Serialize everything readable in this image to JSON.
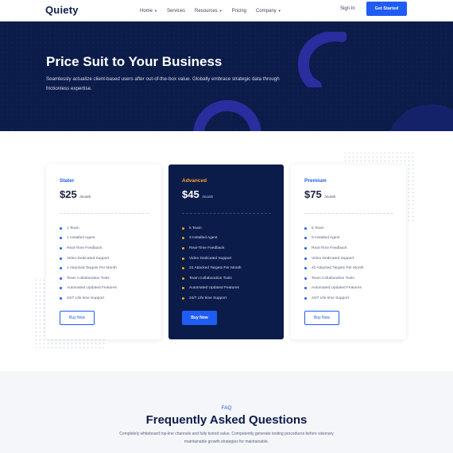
{
  "header": {
    "logo": "Quiety",
    "nav": [
      {
        "label": "Home",
        "dropdown": true
      },
      {
        "label": "Services",
        "dropdown": false
      },
      {
        "label": "Resources",
        "dropdown": true
      },
      {
        "label": "Pricing",
        "dropdown": false
      },
      {
        "label": "Company",
        "dropdown": true
      }
    ],
    "sign_in": "Sign In",
    "cta": "Get Started"
  },
  "hero": {
    "title": "Price Suit to Your Business",
    "subtitle": "Seamlessly actualize client-based users after out-of-the-box value. Globally embrace strategic data through frictionless expertise."
  },
  "plans": [
    {
      "name": "Stater",
      "price": "$25",
      "period": "/month",
      "features": [
        "1 Team",
        "1 Installed Agent",
        "Real-Time Feedback",
        "Video Dedicated Support",
        "1 Attacked Targets Per Month",
        "Team Collaboration Tools",
        "Automated Updated Features",
        "24/7 Life time Support"
      ],
      "button": "Buy Now",
      "highlighted": false
    },
    {
      "name": "Advanced",
      "price": "$45",
      "period": "/month",
      "features": [
        "5 Team",
        "3 Installed Agent",
        "Real-Time Feedback",
        "Video Dedicated Support",
        "24 Attacked Targets Per Month",
        "Team Collaboration Tools",
        "Automated Updated Features",
        "24/7 Life time Support"
      ],
      "button": "Buy Now",
      "highlighted": true
    },
    {
      "name": "Premium",
      "price": "$75",
      "period": "/month",
      "features": [
        "6 Team",
        "8 Installed Agent",
        "Real-Time Feedback",
        "Video Dedicated Support",
        "40 Attacked Targets Per Month",
        "Team Collaboration Tools",
        "Automated Updated Features",
        "24/7 Life time Support"
      ],
      "button": "Buy Now",
      "highlighted": false
    }
  ],
  "faq": {
    "tag": "FAQ",
    "title": "Frequently Asked Questions",
    "subtitle": "Completely whiteboard top-line channels and fully tested value. Competently generate testing procedures before visionary maintainable growth strategies for maintainable."
  },
  "colors": {
    "primary": "#1f5cf3",
    "navy": "#0c1c4a",
    "accent": "#f7a428",
    "shape": "#2a2d9e"
  }
}
